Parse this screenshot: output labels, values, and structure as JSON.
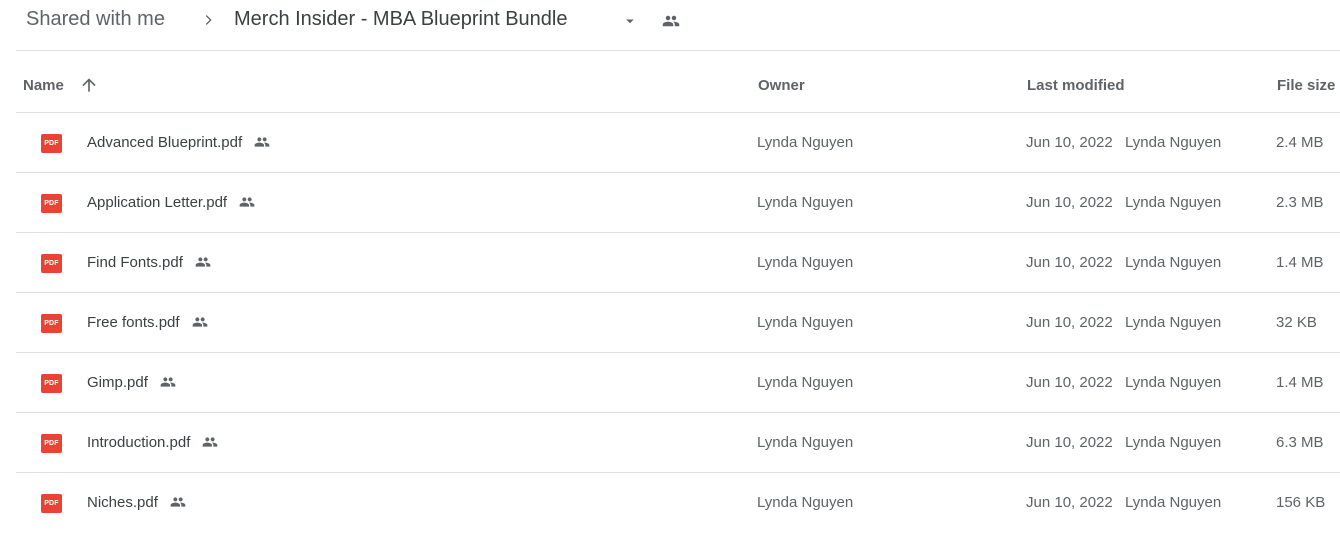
{
  "breadcrumb": {
    "root": "Shared with me",
    "current": "Merch Insider - MBA Blueprint Bundle",
    "separator_icon": "chevron-right-icon",
    "dropdown_icon": "caret-down-icon",
    "shared_icon": "people-icon"
  },
  "table": {
    "columns": {
      "name": "Name",
      "owner": "Owner",
      "modified": "Last modified",
      "size": "File size"
    },
    "sort_icon": "arrow-up-icon",
    "rows": [
      {
        "name": "Advanced Blueprint.pdf",
        "icon_label": "PDF",
        "owner": "Lynda Nguyen",
        "modified_date": "Jun 10, 2022",
        "modified_by": "Lynda Nguyen",
        "size": "2.4 MB"
      },
      {
        "name": "Application Letter.pdf",
        "icon_label": "PDF",
        "owner": "Lynda Nguyen",
        "modified_date": "Jun 10, 2022",
        "modified_by": "Lynda Nguyen",
        "size": "2.3 MB"
      },
      {
        "name": "Find Fonts.pdf",
        "icon_label": "PDF",
        "owner": "Lynda Nguyen",
        "modified_date": "Jun 10, 2022",
        "modified_by": "Lynda Nguyen",
        "size": "1.4 MB"
      },
      {
        "name": "Free fonts.pdf",
        "icon_label": "PDF",
        "owner": "Lynda Nguyen",
        "modified_date": "Jun 10, 2022",
        "modified_by": "Lynda Nguyen",
        "size": "32 KB"
      },
      {
        "name": "Gimp.pdf",
        "icon_label": "PDF",
        "owner": "Lynda Nguyen",
        "modified_date": "Jun 10, 2022",
        "modified_by": "Lynda Nguyen",
        "size": "1.4 MB"
      },
      {
        "name": "Introduction.pdf",
        "icon_label": "PDF",
        "owner": "Lynda Nguyen",
        "modified_date": "Jun 10, 2022",
        "modified_by": "Lynda Nguyen",
        "size": "6.3 MB"
      },
      {
        "name": "Niches.pdf",
        "icon_label": "PDF",
        "owner": "Lynda Nguyen",
        "modified_date": "Jun 10, 2022",
        "modified_by": "Lynda Nguyen",
        "size": "156 KB"
      }
    ]
  },
  "colors": {
    "pdf_red": "#ea4335",
    "text_secondary": "#5f6368",
    "divider": "#e0e0e0"
  }
}
